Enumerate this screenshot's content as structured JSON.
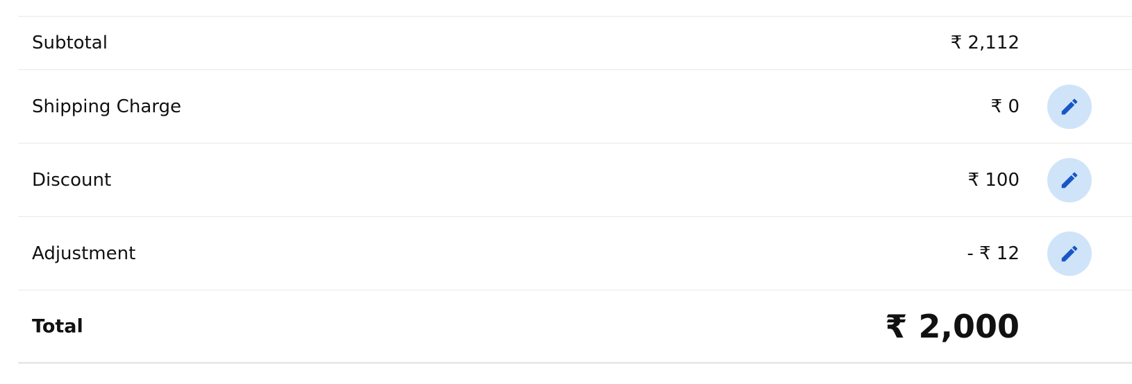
{
  "summary": {
    "rows": [
      {
        "label": "Subtotal",
        "amount": "₹ 2,112"
      },
      {
        "label": "Shipping Charge",
        "amount": "₹ 0",
        "edit_icon": "pencil-icon"
      },
      {
        "label": "Discount",
        "amount": "₹ 100",
        "edit_icon": "pencil-icon"
      },
      {
        "label": "Adjustment",
        "amount": "- ₹ 12",
        "edit_icon": "pencil-icon"
      }
    ],
    "total": {
      "label": "Total",
      "amount": "₹ 2,000"
    }
  },
  "colors": {
    "edit_button_bg": "#cfe4f8",
    "edit_icon": "#1a56c4",
    "divider": "#e8e8e8"
  }
}
